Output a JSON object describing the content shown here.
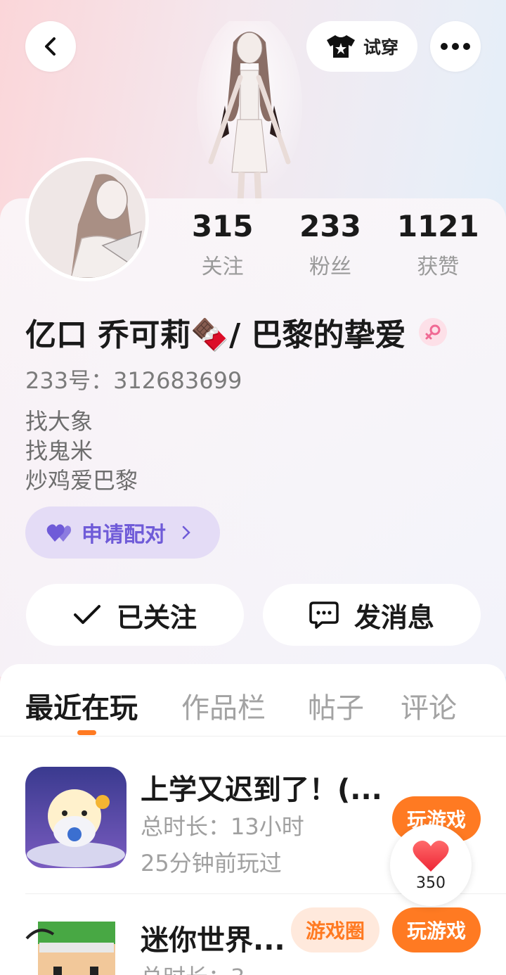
{
  "header": {
    "tryon_label": "试穿"
  },
  "stats": [
    {
      "value": "315",
      "label": "关注"
    },
    {
      "value": "233",
      "label": "粉丝"
    },
    {
      "value": "1121",
      "label": "获赞"
    }
  ],
  "profile": {
    "name": "亿口 乔可莉🍫/ 巴黎的挚爱",
    "uid": "233号：312683699",
    "bio": [
      "找大象",
      "找鬼米",
      "炒鸡爱巴黎"
    ],
    "pair_label": "申请配对"
  },
  "actions": {
    "follow_label": "已关注",
    "message_label": "发消息"
  },
  "tabs": [
    "最近在玩",
    "作品栏",
    "帖子",
    "评论"
  ],
  "games": [
    {
      "title": "上学又迟到了！(...",
      "duration": "总时长：13小时",
      "last_played": "25分钟前玩过",
      "play_label": "玩游戏"
    },
    {
      "title": "迷你世界...",
      "duration": "总时长：3",
      "circle_label": "游戏圈",
      "play_label": "玩游戏"
    }
  ],
  "like": {
    "count": "350"
  },
  "colors": {
    "accent": "#ff7a22",
    "pair": "#6f5bd8"
  }
}
